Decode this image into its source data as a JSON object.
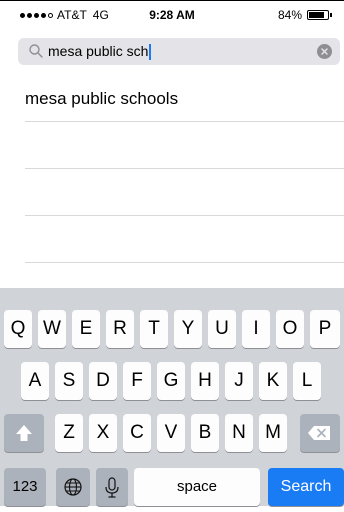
{
  "status_bar": {
    "signal_dots_filled": 4,
    "signal_dots_total": 5,
    "carrier": "AT&T",
    "network": "4G",
    "time": "9:28 AM",
    "battery_percent": "84%",
    "battery_level": 0.84
  },
  "search": {
    "query": "mesa public sch",
    "search_icon": "magnifier-icon",
    "clear_icon": "clear-x-icon"
  },
  "suggestions": [
    "mesa public schools",
    "",
    "",
    ""
  ],
  "keyboard": {
    "row1": [
      "Q",
      "W",
      "E",
      "R",
      "T",
      "Y",
      "U",
      "I",
      "O",
      "P"
    ],
    "row2": [
      "A",
      "S",
      "D",
      "F",
      "G",
      "H",
      "J",
      "K",
      "L"
    ],
    "row3": [
      "Z",
      "X",
      "C",
      "V",
      "B",
      "N",
      "M"
    ],
    "shift_icon": "shift-arrow-icon",
    "delete_icon": "backspace-icon",
    "numbers_label": "123",
    "globe_icon": "globe-icon",
    "mic_icon": "microphone-icon",
    "space_label": "space",
    "search_label": "Search",
    "search_key_color": "#1a7cf5"
  }
}
